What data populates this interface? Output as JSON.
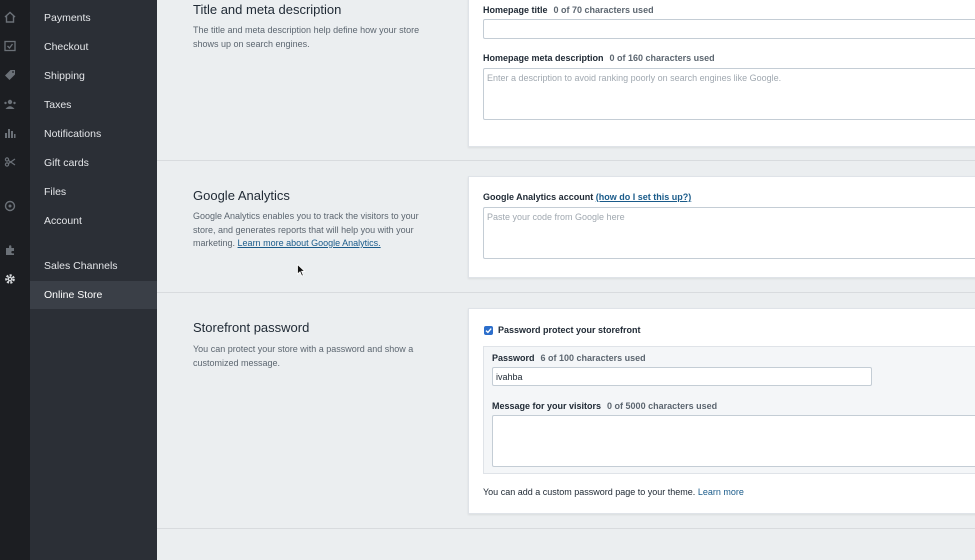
{
  "icon_bar": {
    "icons": [
      "home-icon",
      "orders-icon",
      "tag-icon",
      "customers-icon",
      "reports-icon",
      "discounts-icon",
      "apps-icon",
      "puzzle-icon",
      "gear-icon"
    ]
  },
  "nav": {
    "items": [
      {
        "label": "Payments"
      },
      {
        "label": "Checkout"
      },
      {
        "label": "Shipping"
      },
      {
        "label": "Taxes"
      },
      {
        "label": "Notifications"
      },
      {
        "label": "Gift cards"
      },
      {
        "label": "Files"
      },
      {
        "label": "Account"
      },
      {
        "label": "Sales Channels"
      },
      {
        "label": "Online Store"
      }
    ],
    "active": "Online Store"
  },
  "meta_section": {
    "title": "Title and meta description",
    "description": "The title and meta description help define how your store shows up on search engines.",
    "homepage_title_label": "Homepage title",
    "homepage_title_count": "0 of 70 characters used",
    "homepage_title_value": "",
    "meta_description_label": "Homepage meta description",
    "meta_description_count": "0 of 160 characters used",
    "meta_description_placeholder": "Enter a description to avoid ranking poorly on search engines like Google."
  },
  "analytics_section": {
    "title": "Google Analytics",
    "description": "Google Analytics enables you to track the visitors to your store, and generates reports that will help you with your marketing.",
    "learn_more": "Learn more about Google Analytics.",
    "account_label": "Google Analytics account",
    "help_link": "(how do I set this up?)",
    "account_placeholder": "Paste your code from Google here"
  },
  "password_section": {
    "title": "Storefront password",
    "description": "You can protect your store with a password and show a customized message.",
    "protect_label": "Password protect your storefront",
    "protect_checked": true,
    "password_label": "Password",
    "password_count": "6 of 100 characters used",
    "password_value": "ivahba",
    "message_label": "Message for your visitors",
    "message_count": "0 of 5000 characters used",
    "message_value": "",
    "footer_note": "You can add a custom password page to your theme.",
    "footer_link": "Learn more"
  },
  "colors": {
    "accent": "#2c6ecb",
    "link": "#1a5b8a",
    "sidebar": "#2b2f36",
    "icon_bar": "#1c1e22"
  }
}
